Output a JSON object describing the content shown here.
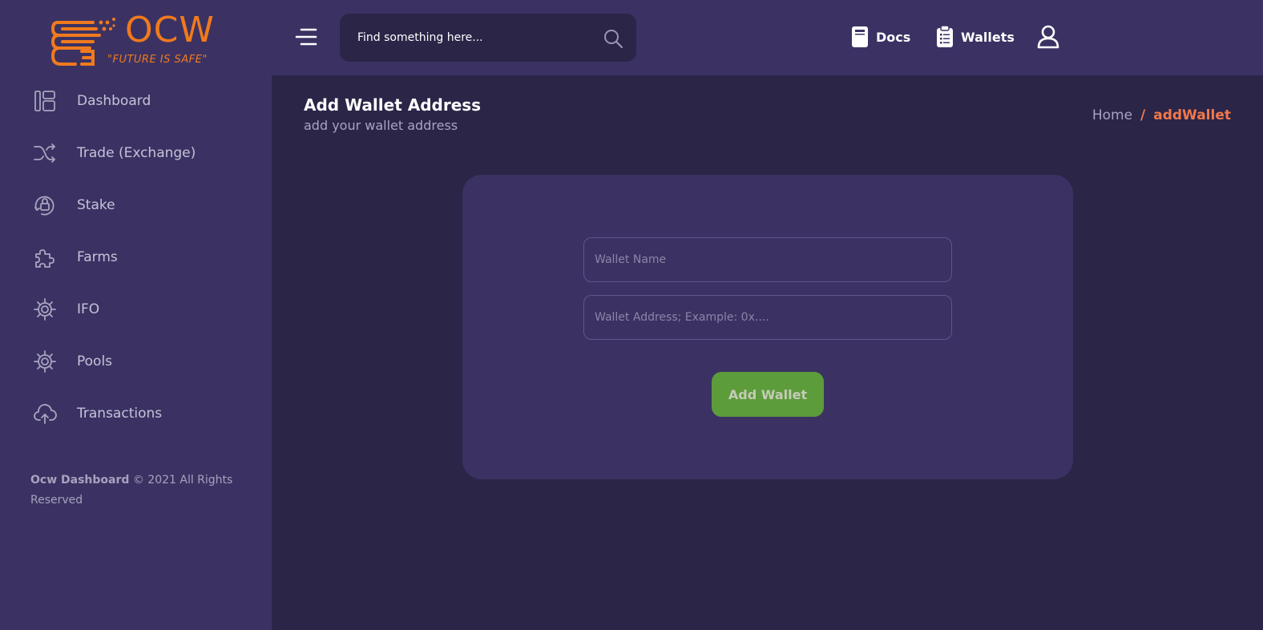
{
  "brand": {
    "name": "OCW",
    "tagline": "\"FUTURE IS SAFE\"",
    "color": "#f07a1d"
  },
  "search": {
    "placeholder": "Find something here..."
  },
  "topnav": {
    "docs_label": "Docs",
    "wallets_label": "Wallets"
  },
  "sidebar": {
    "items": [
      {
        "label": "Dashboard",
        "icon": "dashboard-icon"
      },
      {
        "label": "Trade (Exchange)",
        "icon": "shuffle-icon"
      },
      {
        "label": "Stake",
        "icon": "stake-lock-icon"
      },
      {
        "label": "Farms",
        "icon": "puzzle-icon"
      },
      {
        "label": "IFO",
        "icon": "gear-icon"
      },
      {
        "label": "Pools",
        "icon": "gear-icon"
      },
      {
        "label": "Transactions",
        "icon": "cloud-upload-icon"
      }
    ],
    "footer": {
      "brand": "Ocw Dashboard",
      "rights": " © 2021 All Rights Reserved"
    }
  },
  "page": {
    "title": "Add Wallet Address",
    "subtitle": "add your wallet address"
  },
  "breadcrumb": {
    "home": "Home",
    "separator": "/",
    "current": "addWallet"
  },
  "form": {
    "wallet_name_placeholder": "Wallet Name",
    "wallet_name_value": "",
    "wallet_address_placeholder": "Wallet Address; Example: 0x....",
    "wallet_address_value": "",
    "submit_label": "Add Wallet"
  },
  "colors": {
    "header_bg": "#3b3263",
    "content_bg": "#2b2548",
    "accent": "#f2784b",
    "button": "#5c9c3a"
  }
}
